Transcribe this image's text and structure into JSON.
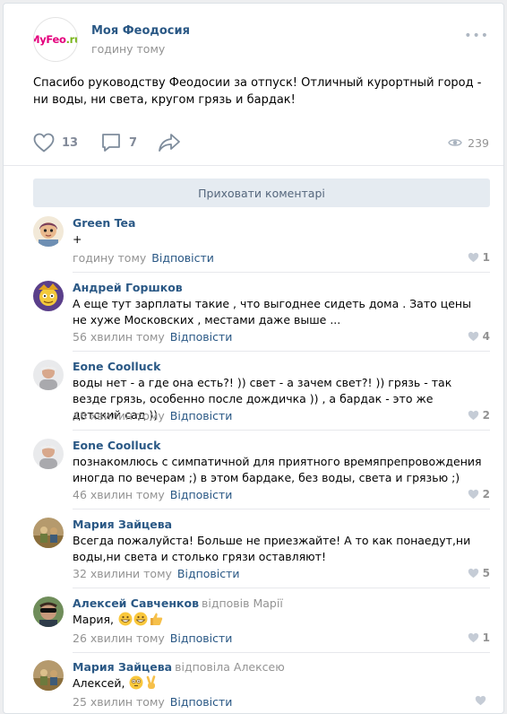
{
  "post": {
    "author": "Моя Феодосия",
    "time": "годину тому",
    "logo": {
      "part1": "My",
      "part2": "Feo",
      "part3": ".ru"
    },
    "text": "Спасибо руководству Феодосии за отпуск! Отличный курортный город - ни воды, ни света, кругом грязь и бардак!",
    "likes": "13",
    "comments": "7",
    "views": "239",
    "more_icon": "ellipsis-icon"
  },
  "hide_comments_label": "Приховати коментарі",
  "colors": {
    "link": "#2a5885",
    "meta": "#939393",
    "button_bg": "#e5ebf1",
    "logo_pink": "#e4007d",
    "logo_green": "#7ab51d"
  },
  "comments": [
    {
      "name": "Green Tea",
      "reply_to": "",
      "text": "+",
      "time": "годину тому",
      "reply": "Відповісти",
      "likes": "1"
    },
    {
      "name": "Андрей Горшков",
      "reply_to": "",
      "text": "А еще тут зарплаты такие , что выгоднее сидеть дома . Зато цены не хуже Московских , местами даже выше ...",
      "time": "56 хвилин тому",
      "reply": "Відповісти",
      "likes": "4"
    },
    {
      "name": "Eone Coolluck",
      "reply_to": "",
      "text": "воды нет - а где она есть?! )) свет - а зачем свет?! )) грязь - так везде грязь, особенно после дождичка )) , а бардак - это же детский сад ))",
      "time": "48 хвилин тому",
      "reply": "Відповісти",
      "likes": "2"
    },
    {
      "name": "Eone Coolluck",
      "reply_to": "",
      "text": "познакомлюсь с симпатичной для приятного времяпрепровождения иногда по вечерам ;) в этом бардаке, без воды, света и грязью ;)",
      "time": "46 хвилин тому",
      "reply": "Відповісти",
      "likes": "2"
    },
    {
      "name": "Мария Зайцева",
      "reply_to": "",
      "text": "Всегда пожалуйста! Больше не приезжайте! А то как понаедут,ни воды,ни света и столько грязи оставляют!",
      "time": "32 хвилини тому",
      "reply": "Відповісти",
      "likes": "5"
    },
    {
      "name": "Алексей Савченков",
      "reply_to": "відповів Марії",
      "text": "Мария,",
      "time": "26 хвилин тому",
      "reply": "Відповісти",
      "likes": "1"
    },
    {
      "name": "Мария Зайцева",
      "reply_to": "відповіла Алексею",
      "text": "Алексей,",
      "time": "25 хвилин тому",
      "reply": "Відповісти",
      "likes": ""
    }
  ]
}
